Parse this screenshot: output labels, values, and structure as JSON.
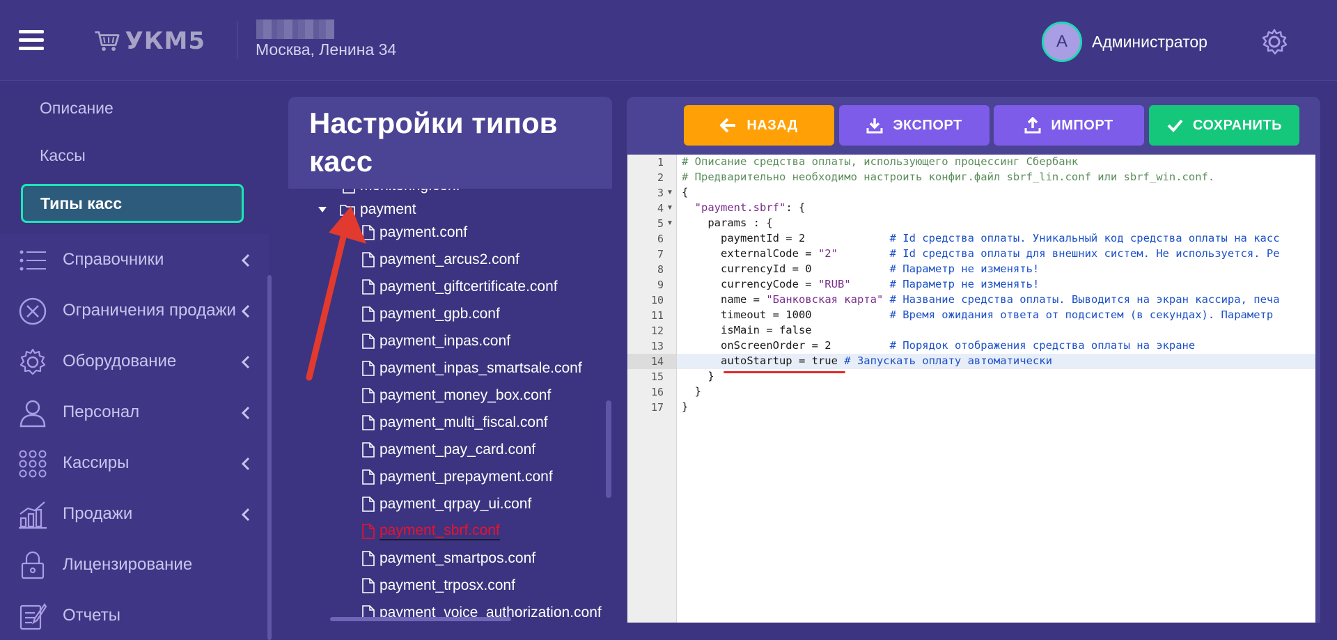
{
  "header": {
    "logo_text": "УКМ5",
    "store_address": "Москва, Ленина 34",
    "avatar_letter": "А",
    "username": "Администратор"
  },
  "sidebar": {
    "sub_items": [
      "Описание",
      "Кассы"
    ],
    "active_item": "Типы касс",
    "items": [
      {
        "label": "Справочники",
        "icon": "list-icon",
        "has_chevron": true
      },
      {
        "label": "Ограничения продажи",
        "icon": "cancel-circle-icon",
        "has_chevron": true
      },
      {
        "label": "Оборудование",
        "icon": "gear-icon",
        "has_chevron": true
      },
      {
        "label": "Персонал",
        "icon": "person-icon",
        "has_chevron": true
      },
      {
        "label": "Кассиры",
        "icon": "dots-grid-icon",
        "has_chevron": true
      },
      {
        "label": "Продажи",
        "icon": "bar-chart-icon",
        "has_chevron": true
      },
      {
        "label": "Лицензирование",
        "icon": "lock-icon",
        "has_chevron": false
      },
      {
        "label": "Отчеты",
        "icon": "report-icon",
        "has_chevron": false
      }
    ]
  },
  "tree": {
    "title": "Настройки типов касс",
    "cut_top_item": "monitoring.conf",
    "folder": "payment",
    "files": [
      "payment.conf",
      "payment_arcus2.conf",
      "payment_giftcertificate.conf",
      "payment_gpb.conf",
      "payment_inpas.conf",
      "payment_inpas_smartsale.conf",
      "payment_money_box.conf",
      "payment_multi_fiscal.conf",
      "payment_pay_card.conf",
      "payment_prepayment.conf",
      "payment_qrpay_ui.conf",
      "payment_sbrf.conf",
      "payment_smartpos.conf",
      "payment_trposx.conf",
      "payment_voice_authorization.conf"
    ],
    "selected_file": "payment_sbrf.conf"
  },
  "toolbar": {
    "back_label": "НАЗАД",
    "export_label": "ЭКСПОРТ",
    "import_label": "ИМПОРТ",
    "save_label": "СОХРАНИТЬ",
    "colors": {
      "back": "#ffa006",
      "export": "#7c5ce8",
      "import": "#7c5ce8",
      "save": "#14c77a"
    }
  },
  "editor": {
    "highlighted_line": 14,
    "lines": [
      "# Описание средства оплаты, использующего процессинг Сбербанк",
      "# Предварительно необходимо настроить конфиг.файл sbrf_lin.conf или sbrf_win.conf.",
      "{",
      "  \"payment.sbrf\": {",
      "    params : {",
      "      paymentId = 2             # Id средства оплаты. Уникальный код средства оплаты на касс",
      "      externalCode = \"2\"        # Id средства оплаты для внешних систем. Не используется. Ре",
      "      currencyId = 0            # Параметр не изменять!",
      "      currencyCode = \"RUB\"      # Параметр не изменять!",
      "      name = \"Банковская карта\" # Название средства оплаты. Выводится на экран кассира, печа",
      "      timeout = 1000            # Время ожидания ответа от подсистем (в секундах). Параметр",
      "      isMain = false",
      "      onScreenOrder = 2         # Порядок отображения средства оплаты на экране",
      "      autoStartup = true # Запускать оплату автоматически",
      "    }",
      "  }",
      "}"
    ]
  }
}
